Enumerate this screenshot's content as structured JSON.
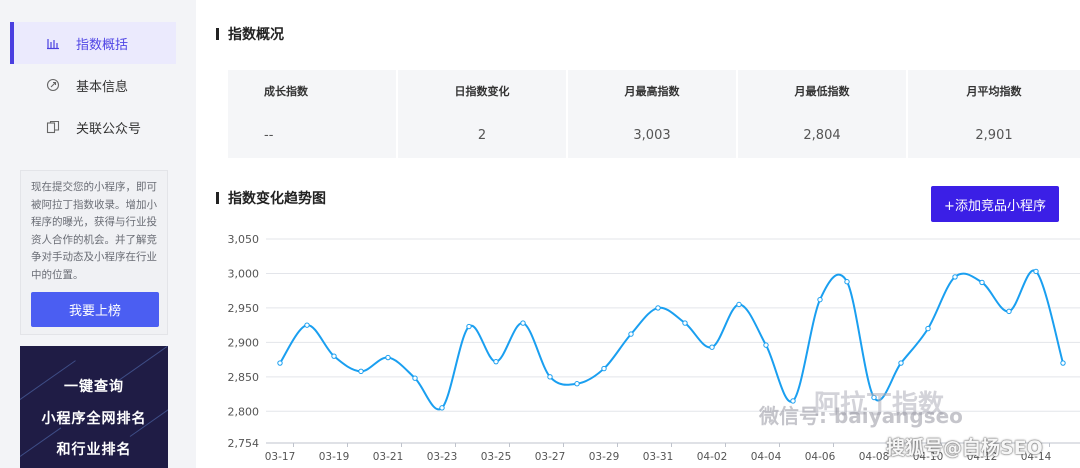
{
  "sidebar": {
    "items": [
      {
        "label": "指数概括",
        "icon": "bar-chart-icon",
        "active": true
      },
      {
        "label": "基本信息",
        "icon": "info-circle-icon",
        "active": false
      },
      {
        "label": "关联公众号",
        "icon": "copy-icon",
        "active": false
      }
    ],
    "promo": {
      "text": "现在提交您的小程序，即可被阿拉丁指数收录。增加小程序的曝光，获得与行业投资人合作的机会。并了解竞争对手动态及小程序在行业中的位置。",
      "button_label": "我要上榜"
    },
    "banner": {
      "lines": [
        "一键查询",
        "小程序全网排名",
        "和行业排名"
      ]
    }
  },
  "overview": {
    "title": "指数概况",
    "headers": [
      "成长指数",
      "日指数变化",
      "月最高指数",
      "月最低指数",
      "月平均指数"
    ],
    "values": [
      "--",
      "2",
      "3,003",
      "2,804",
      "2,901"
    ]
  },
  "trend": {
    "title": "指数变化趋势图",
    "add_button_label": "+添加竞品小程序"
  },
  "watermarks": {
    "logo_text": "阿拉丁指数",
    "wechat_text": "微信号: baiyangseo",
    "sohu_text": "搜狐号@白杨SEO"
  },
  "colors": {
    "accent": "#4a3fe0",
    "line": "#1a9ff0",
    "button": "#3b1fe6"
  },
  "chart_data": {
    "type": "line",
    "title": "",
    "xlabel": "",
    "ylabel": "",
    "ylim": [
      2754,
      3050
    ],
    "yticks": [
      2754,
      2800,
      2850,
      2900,
      2950,
      3000,
      3050
    ],
    "ytick_labels": [
      "2,754",
      "2,800",
      "2,850",
      "2,900",
      "2,950",
      "3,000",
      "3,050"
    ],
    "xtick_labels": [
      "03-17",
      "03-19",
      "03-21",
      "03-23",
      "03-25",
      "03-27",
      "03-29",
      "03-31",
      "04-02",
      "04-04",
      "04-06",
      "04-08",
      "04-10",
      "04-12",
      "04-14"
    ],
    "x": [
      "03-17",
      "03-18",
      "03-19",
      "03-20",
      "03-21",
      "03-22",
      "03-23",
      "03-24",
      "03-25",
      "03-26",
      "03-27",
      "03-28",
      "03-29",
      "03-30",
      "03-31",
      "04-01",
      "04-02",
      "04-03",
      "04-04",
      "04-05",
      "04-06",
      "04-07",
      "04-08",
      "04-09",
      "04-10",
      "04-11",
      "04-12",
      "04-13",
      "04-14",
      "04-15"
    ],
    "series": [
      {
        "values": [
          2870,
          2925,
          2880,
          2858,
          2878,
          2848,
          2805,
          2923,
          2872,
          2928,
          2850,
          2840,
          2862,
          2912,
          2950,
          2928,
          2893,
          2955,
          2896,
          2815,
          2962,
          2988,
          2820,
          2870,
          2920,
          2995,
          2987,
          2945,
          3003,
          2870
        ]
      }
    ],
    "grid": true
  }
}
